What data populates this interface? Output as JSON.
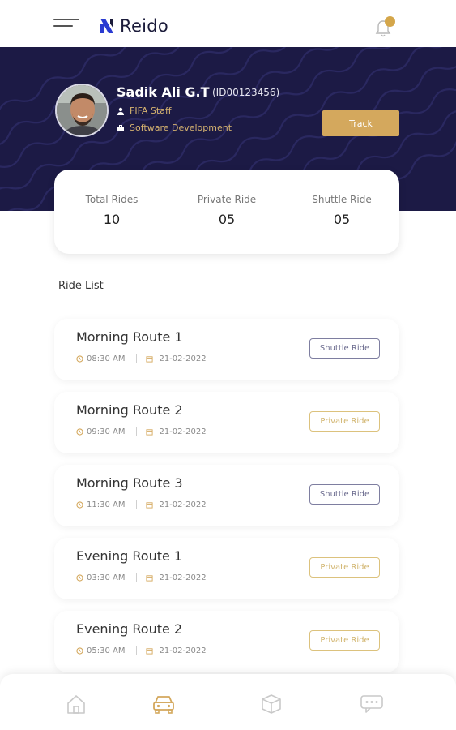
{
  "app": {
    "brand_name": "Reido"
  },
  "colors": {
    "navy": "#1c1a45",
    "gold": "#d4a85d",
    "shuttle_badge": "#7e7ea0",
    "private_badge": "#d1b46d"
  },
  "user": {
    "name": "Sadik Ali G.T",
    "id": "(ID00123456)",
    "role": "FIFA Staff",
    "department": "Software Development"
  },
  "actions": {
    "track_label": "Track"
  },
  "stats": [
    {
      "label": "Total Rides",
      "value": "10"
    },
    {
      "label": "Private Ride",
      "value": "05"
    },
    {
      "label": "Shuttle Ride",
      "value": "05"
    }
  ],
  "ride_list": {
    "title": "Ride List",
    "items": [
      {
        "title": "Morning Route 1",
        "time": "08:30 AM",
        "date": "21-02-2022",
        "type": "Shuttle Ride",
        "kind": "shuttle"
      },
      {
        "title": "Morning Route 2",
        "time": "09:30 AM",
        "date": "21-02-2022",
        "type": "Private Ride",
        "kind": "private"
      },
      {
        "title": "Morning Route 3",
        "time": "11:30 AM",
        "date": "21-02-2022",
        "type": "Shuttle Ride",
        "kind": "shuttle"
      },
      {
        "title": "Evening Route 1",
        "time": "03:30 AM",
        "date": "21-02-2022",
        "type": "Private Ride",
        "kind": "private"
      },
      {
        "title": "Evening Route 2",
        "time": "05:30 AM",
        "date": "21-02-2022",
        "type": "Private Ride",
        "kind": "private"
      }
    ]
  },
  "bottom_nav": {
    "items": [
      {
        "icon": "home-icon",
        "active": false
      },
      {
        "icon": "car-icon",
        "active": true
      },
      {
        "icon": "box-icon",
        "active": false
      },
      {
        "icon": "chat-icon",
        "active": false
      }
    ]
  }
}
